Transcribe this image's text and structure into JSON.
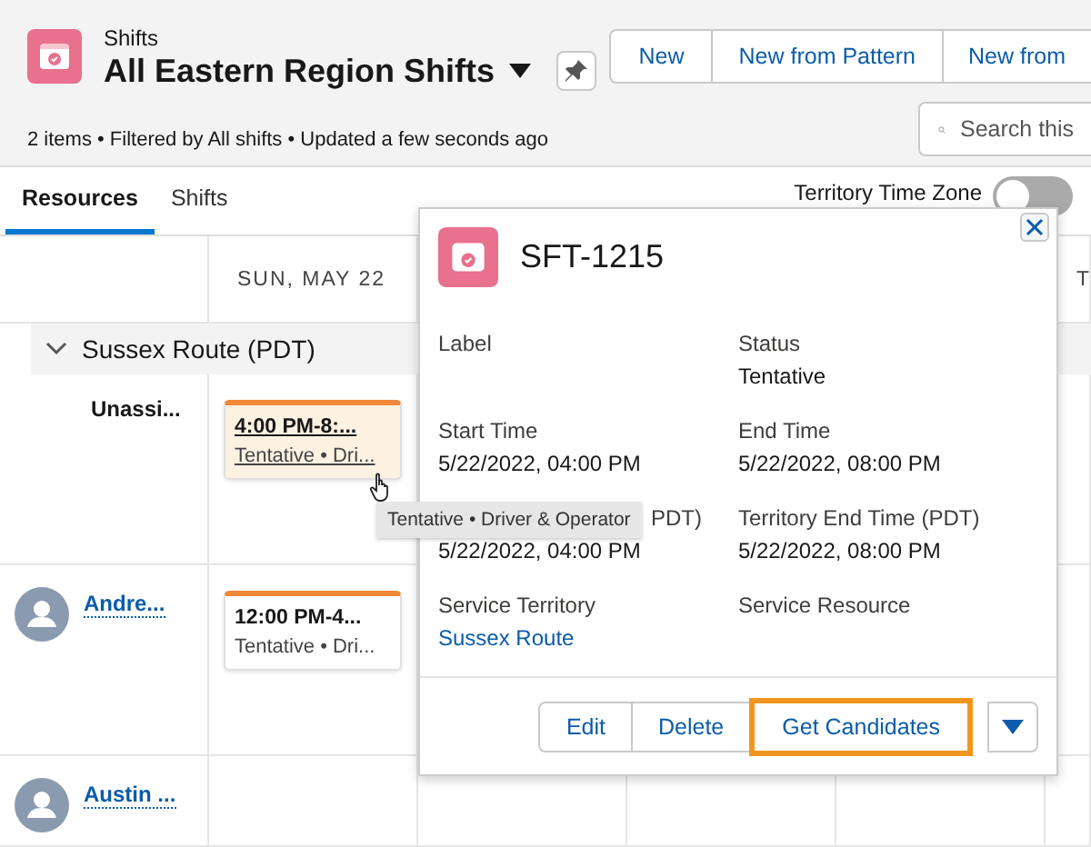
{
  "header": {
    "object": "Shifts",
    "title": "All Eastern Region Shifts",
    "subtitle": "2 items • Filtered by All shifts • Updated a few seconds ago",
    "buttons": [
      "New",
      "New from Pattern",
      "New from"
    ],
    "search": {
      "placeholder": "Search this"
    }
  },
  "tabs": [
    {
      "label": "Resources",
      "selected": true
    },
    {
      "label": "Shifts",
      "selected": false
    }
  ],
  "time_zone_toggle": {
    "label": "Territory Time Zone",
    "on": false
  },
  "grid": {
    "columns": [
      "SUN, MAY 22",
      "T"
    ],
    "group": {
      "label": "Sussex Route (PDT)",
      "expanded": true
    },
    "rows": [
      {
        "kind": "unassigned",
        "name": "Unassi...",
        "shift": {
          "time": "4:00 PM-8:...",
          "detail": "Tentative • Dri...",
          "selected": true
        }
      },
      {
        "kind": "resource",
        "name": "Andre...",
        "shift": {
          "time": "12:00 PM-4...",
          "detail": "Tentative • Dri...",
          "selected": false
        }
      },
      {
        "kind": "resource",
        "name": "Austin ..."
      }
    ]
  },
  "popover": {
    "title": "SFT-1215",
    "fields": [
      {
        "label": "Label",
        "kind": "text"
      },
      {
        "label": "Status",
        "value": "Tentative",
        "kind": "text"
      },
      {
        "label": "Start Time",
        "value": "5/22/2022, 04:00 PM",
        "kind": "text"
      },
      {
        "label": "End Time",
        "value": "5/22/2022, 08:00 PM",
        "kind": "text"
      },
      {
        "label": "PDT)",
        "value": "5/22/2022, 04:00 PM",
        "kind": "covered"
      },
      {
        "label": "Territory End Time (PDT)",
        "value": "5/22/2022, 08:00 PM",
        "kind": "text"
      },
      {
        "label": "Service Territory",
        "value": "Sussex Route",
        "kind": "link"
      },
      {
        "label": "Service Resource",
        "kind": "text"
      }
    ],
    "actions": [
      {
        "label": "Edit",
        "highlighted": false
      },
      {
        "label": "Delete",
        "highlighted": false
      },
      {
        "label": "Get Candidates",
        "highlighted": true
      }
    ]
  },
  "tooltip": "Tentative • Driver & Operator"
}
